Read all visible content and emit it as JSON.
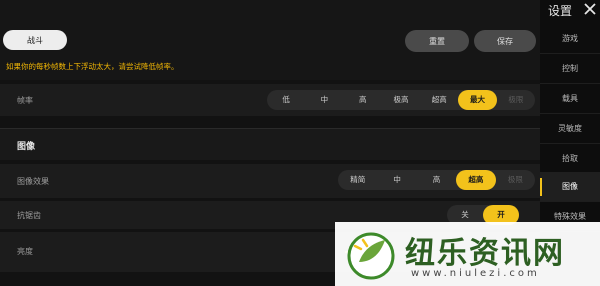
{
  "header": {
    "mode": "战斗",
    "reset_label": "重置",
    "save_label": "保存",
    "hint": "如果你的每秒帧数上下浮动太大，请尝试降低帧率。"
  },
  "framerate": {
    "label": "帧率",
    "options": [
      "低",
      "中",
      "高",
      "极高",
      "超高",
      "最大",
      "极限"
    ],
    "selected": "最大"
  },
  "image_section": {
    "title": "图像",
    "quality_label": "图像效果",
    "quality_options": [
      "精简",
      "中",
      "高",
      "超高",
      "极限"
    ],
    "quality_selected": "超高",
    "aa_label": "抗锯齿",
    "aa_options": [
      "关",
      "开"
    ],
    "aa_selected": "开",
    "brightness_label": "亮度"
  },
  "sidebar": {
    "title": "设置",
    "items": [
      "游戏",
      "控制",
      "载具",
      "灵敏度",
      "拾取",
      "图像",
      "特殊效果"
    ],
    "active": "图像"
  },
  "watermark": {
    "text": "纽乐资讯网",
    "url": "www.niulezi.com"
  },
  "colors": {
    "accent": "#f3c21b",
    "hint": "#f2b705"
  }
}
